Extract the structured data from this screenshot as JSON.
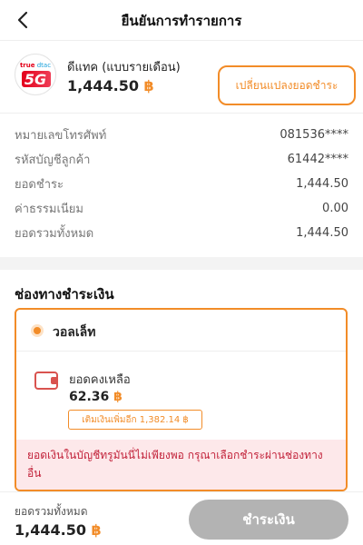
{
  "header": {
    "title": "ยืนยันการทำรายการ",
    "back_icon": "chevron-left-icon"
  },
  "bill": {
    "logo_true": "true",
    "logo_dtac": "dtac",
    "logo_5g": "5G",
    "provider_name": "ดีแทค (แบบรายเดือน)",
    "amount": "1,444.50",
    "currency_symbol": "฿",
    "change_button": "เปลี่ยนแปลงยอดชำระ"
  },
  "details": [
    {
      "label": "หมายเลขโทรศัพท์",
      "value": "081536****"
    },
    {
      "label": "รหัสบัญชีลูกค้า",
      "value": "61442****"
    },
    {
      "label": "ยอดชำระ",
      "value": "1,444.50"
    },
    {
      "label": "ค่าธรรมเนียม",
      "value": "0.00"
    },
    {
      "label": "ยอดรวมทั้งหมด",
      "value": "1,444.50"
    }
  ],
  "payment": {
    "section_title": "ช่องทางชำระเงิน",
    "method_label": "วอลเล็ท",
    "balance_label": "ยอดคงเหลือ",
    "balance_amount": "62.36",
    "topup_label": "เติมเงินเพิ่มอีก 1,382.14 ฿",
    "warning": "ยอดเงินในบัญชีทรูมันนี่ไม่เพียงพอ กรุณาเลือกชำระผ่านช่องทางอื่น"
  },
  "footer": {
    "total_label": "ยอดรวมทั้งหมด",
    "total_amount": "1,444.50",
    "pay_button": "ชำระเงิน"
  },
  "colors": {
    "accent": "#f28c28",
    "warning_bg": "#fde8ea",
    "warning_text": "#c2223a",
    "disabled_button": "#b3b3b3"
  }
}
